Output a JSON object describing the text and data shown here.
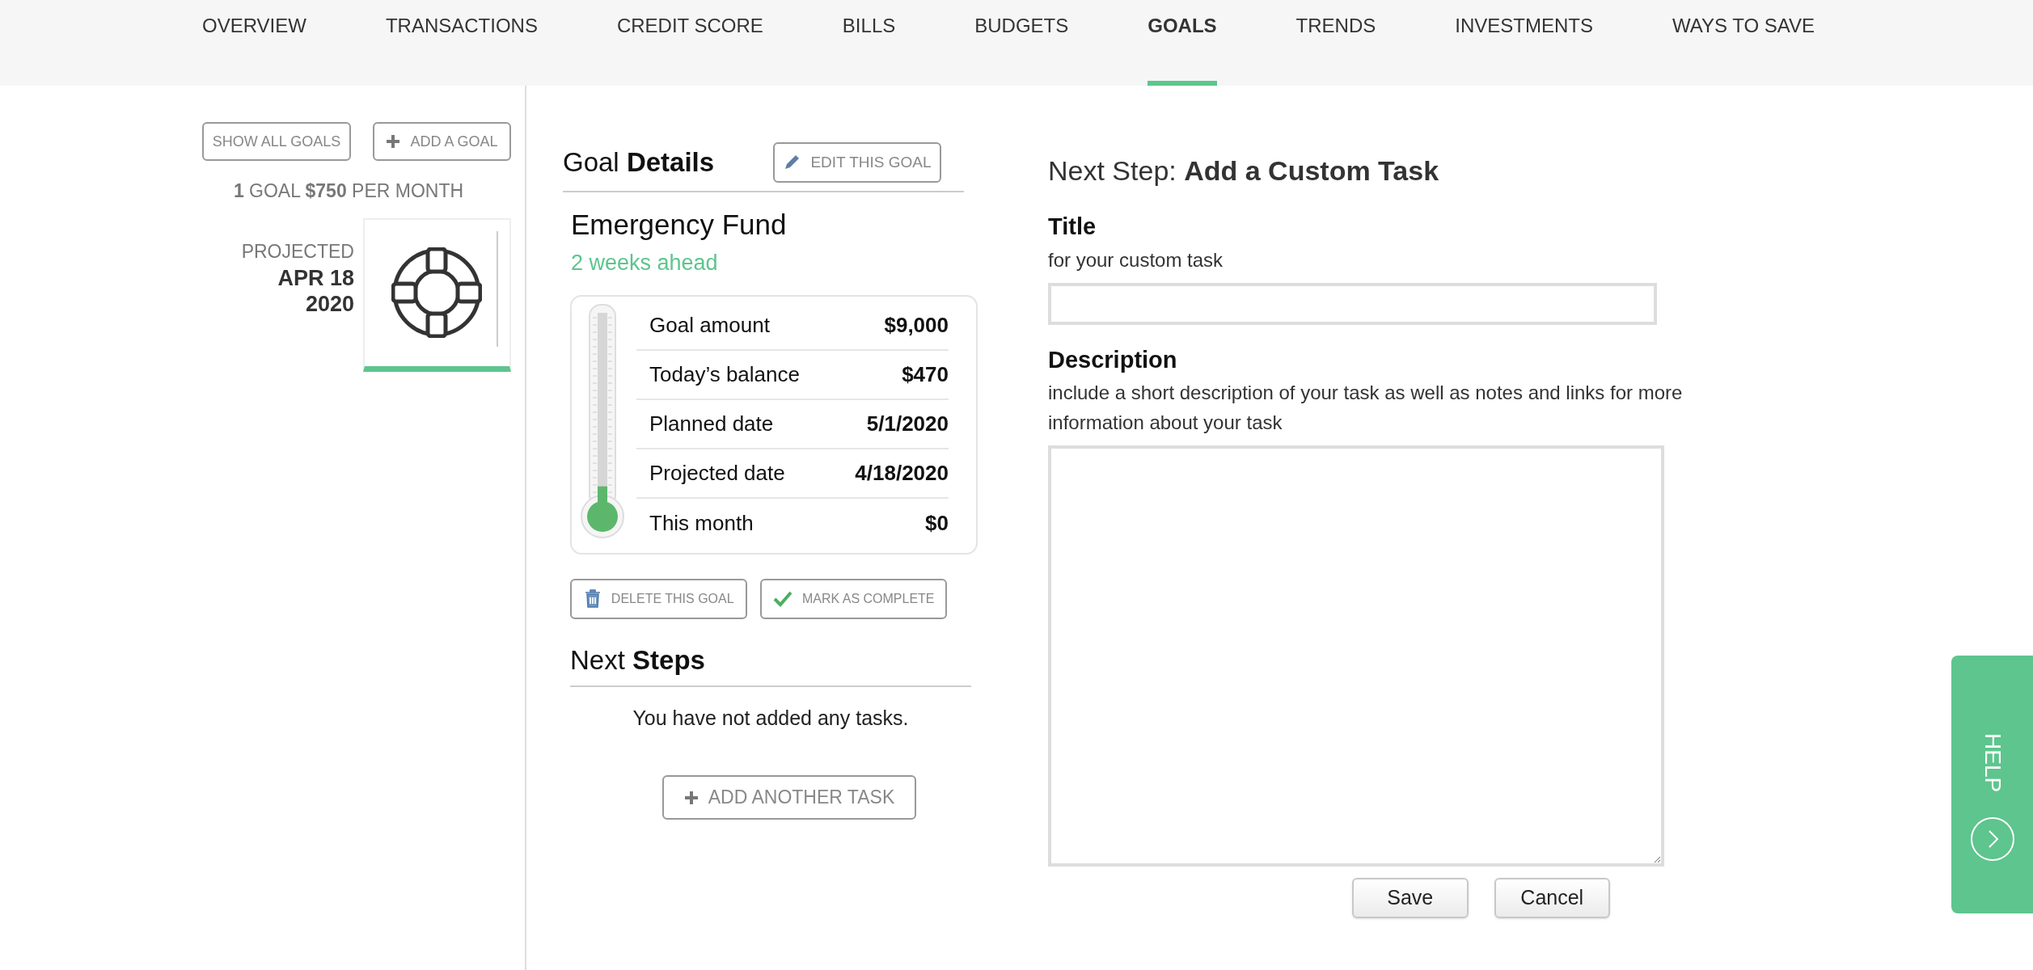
{
  "nav": [
    {
      "label": "OVERVIEW",
      "selected": false
    },
    {
      "label": "TRANSACTIONS",
      "selected": false
    },
    {
      "label": "CREDIT SCORE",
      "selected": false
    },
    {
      "label": "BILLS",
      "selected": false
    },
    {
      "label": "BUDGETS",
      "selected": false
    },
    {
      "label": "GOALS",
      "selected": true
    },
    {
      "label": "TRENDS",
      "selected": false
    },
    {
      "label": "INVESTMENTS",
      "selected": false
    },
    {
      "label": "WAYS TO SAVE",
      "selected": false
    }
  ],
  "sidebar": {
    "buttons": [
      {
        "kind": "plain",
        "label": "SHOW ALL GOALS"
      },
      {
        "kind": "add",
        "label": "ADD A GOAL"
      }
    ],
    "summary": "**1** GOAL **$750** PER MONTH",
    "projected_label": "PROJECTED",
    "projected_date": [
      "APR 18",
      "2020"
    ],
    "goal_tile": {
      "selected": true
    }
  },
  "details": {
    "heading": "Goal **Details**",
    "edit_button": "EDIT THIS GOAL",
    "goal_name": "Emergency Fund",
    "status": "2 weeks ahead",
    "thermometer": {
      "level": 0.05
    },
    "rows": [
      {
        "label": "Goal amount",
        "value": "$9,000"
      },
      {
        "label": "Today’s balance",
        "value": "$470"
      },
      {
        "label": "Planned date",
        "value": "5/1/2020"
      },
      {
        "label": "Projected date",
        "value": "4/18/2020"
      },
      {
        "label": "This month",
        "value": "$0"
      }
    ],
    "actions": [
      {
        "kind": "delete",
        "label": "DELETE THIS GOAL"
      },
      {
        "kind": "complete",
        "label": "MARK AS COMPLETE"
      }
    ],
    "next_steps_heading": "Next **Steps**",
    "empty_message": "You have not added any tasks.",
    "add_task_button": "ADD ANOTHER TASK"
  },
  "form": {
    "heading": "Next Step: **Add a Custom Task**",
    "fields": [
      {
        "kind": "input",
        "label": "Title",
        "hint": "for your custom task"
      },
      {
        "kind": "textarea",
        "label": "Description",
        "hint": "include a short description of your task as well as notes and links for more information about your task"
      }
    ],
    "buttons": [
      "Save",
      "Cancel"
    ]
  },
  "help": {
    "label": "HELP"
  }
}
